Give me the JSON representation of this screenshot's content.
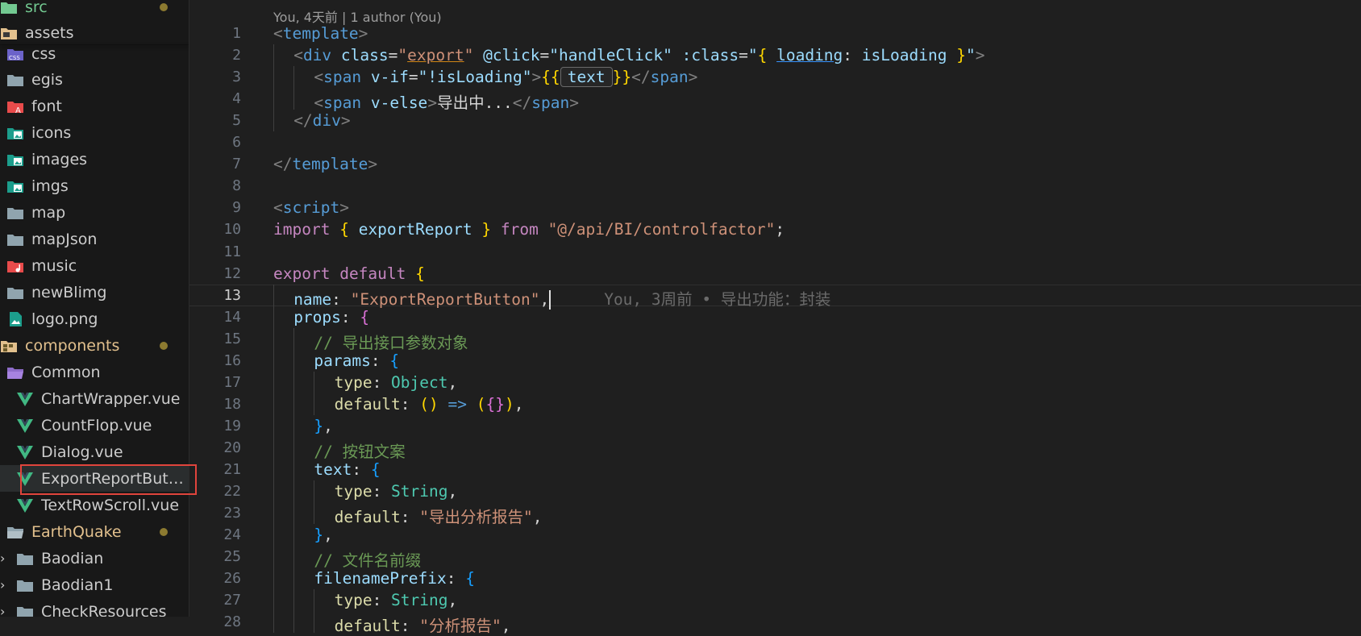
{
  "explorer": {
    "rows": [
      {
        "label": "src",
        "kind": "folder-src",
        "color": "#73c991",
        "modified": true
      },
      {
        "label": "assets",
        "kind": "folder-assets",
        "color": "#cccccc",
        "modified": false
      },
      {
        "label": "css",
        "kind": "folder-css",
        "color": "#cccccc",
        "modified": false
      },
      {
        "label": "egis",
        "kind": "folder",
        "color": "#cccccc",
        "modified": false
      },
      {
        "label": "font",
        "kind": "folder-font",
        "color": "#cccccc",
        "modified": false
      },
      {
        "label": "icons",
        "kind": "folder-images",
        "color": "#cccccc",
        "modified": false
      },
      {
        "label": "images",
        "kind": "folder-images",
        "color": "#cccccc",
        "modified": false
      },
      {
        "label": "imgs",
        "kind": "folder-images",
        "color": "#cccccc",
        "modified": false
      },
      {
        "label": "map",
        "kind": "folder",
        "color": "#cccccc",
        "modified": false
      },
      {
        "label": "mapJson",
        "kind": "folder",
        "color": "#cccccc",
        "modified": false
      },
      {
        "label": "music",
        "kind": "folder-music",
        "color": "#cccccc",
        "modified": false
      },
      {
        "label": "newBlimg",
        "kind": "folder",
        "color": "#cccccc",
        "modified": false
      },
      {
        "label": "logo.png",
        "kind": "file-image",
        "color": "#cccccc",
        "modified": false
      },
      {
        "label": "components",
        "kind": "folder-components",
        "color": "#e2c08d",
        "modified": true
      },
      {
        "label": "Common",
        "kind": "folder-open-purple",
        "color": "#cccccc",
        "modified": false
      },
      {
        "label": "ChartWrapper.vue",
        "kind": "vue",
        "color": "#cccccc",
        "modified": false
      },
      {
        "label": "CountFlop.vue",
        "kind": "vue",
        "color": "#cccccc",
        "modified": false
      },
      {
        "label": "Dialog.vue",
        "kind": "vue",
        "color": "#cccccc",
        "modified": false
      },
      {
        "label": "ExportReportButto...",
        "kind": "vue",
        "color": "#cccccc",
        "modified": false
      },
      {
        "label": "TextRowScroll.vue",
        "kind": "vue",
        "color": "#cccccc",
        "modified": false
      },
      {
        "label": "EarthQuake",
        "kind": "folder-open",
        "color": "#e2c08d",
        "modified": true
      },
      {
        "label": "Baodian",
        "kind": "folder",
        "color": "#cccccc",
        "modified": false
      },
      {
        "label": "Baodian1",
        "kind": "folder",
        "color": "#cccccc",
        "modified": false
      },
      {
        "label": "CheckResources",
        "kind": "folder",
        "color": "#cccccc",
        "modified": false
      }
    ]
  },
  "editor": {
    "codelens": "You, 4天前 | 1 author (You)",
    "active_line": 13,
    "blame": "You, 3周前 • 导出功能：封装",
    "lines": [
      {
        "n": "1",
        "indent": 0,
        "tokens": [
          [
            "&lt;",
            "t-punc"
          ],
          [
            "template",
            "t-tag"
          ],
          [
            "&gt;",
            "t-punc"
          ]
        ]
      },
      {
        "n": "2",
        "indent": 1,
        "tokens": [
          [
            "&lt;",
            "t-punc"
          ],
          [
            "div",
            "t-tag"
          ],
          [
            " "
          ],
          [
            "class",
            "t-attr"
          ],
          [
            "=",
            "t-op"
          ],
          [
            "\"",
            "t-str"
          ],
          [
            "export",
            "t-str u-orange"
          ],
          [
            "\"",
            "t-str"
          ],
          [
            " "
          ],
          [
            "@click",
            "t-attr"
          ],
          [
            "=",
            "t-op"
          ],
          [
            "\"handleClick\"",
            "t-attr"
          ],
          [
            " "
          ],
          [
            ":class",
            "t-attr"
          ],
          [
            "=",
            "t-op"
          ],
          [
            "\"",
            "t-attr"
          ],
          [
            "{",
            "t-b1"
          ],
          [
            " "
          ],
          [
            "loading",
            "t-var u-blue"
          ],
          [
            ": ",
            "t-op"
          ],
          [
            "isLoading",
            "t-var"
          ],
          [
            " "
          ],
          [
            "}",
            "t-b1"
          ],
          [
            "\"",
            "t-attr"
          ],
          [
            "&gt;",
            "t-punc"
          ]
        ]
      },
      {
        "n": "3",
        "indent": 2,
        "tokens": [
          [
            "&lt;",
            "t-punc"
          ],
          [
            "span",
            "t-tag"
          ],
          [
            " "
          ],
          [
            "v-if",
            "t-attr"
          ],
          [
            "=",
            "t-op"
          ],
          [
            "\"!isLoading\"",
            "t-attr"
          ],
          [
            "&gt;",
            "t-punc"
          ],
          [
            "{{",
            "t-b1"
          ],
          [
            "text",
            "inline-box"
          ],
          [
            "}}",
            "t-b1"
          ],
          [
            "&lt;/",
            "t-punc"
          ],
          [
            "span",
            "t-tag"
          ],
          [
            "&gt;",
            "t-punc"
          ]
        ]
      },
      {
        "n": "4",
        "indent": 2,
        "tokens": [
          [
            "&lt;",
            "t-punc"
          ],
          [
            "span",
            "t-tag"
          ],
          [
            " "
          ],
          [
            "v-else",
            "t-attr"
          ],
          [
            "&gt;",
            "t-punc"
          ],
          [
            "导出中...",
            "t-op"
          ],
          [
            "&lt;/",
            "t-punc"
          ],
          [
            "span",
            "t-tag"
          ],
          [
            "&gt;",
            "t-punc"
          ]
        ]
      },
      {
        "n": "5",
        "indent": 1,
        "tokens": [
          [
            "&lt;/",
            "t-punc"
          ],
          [
            "div",
            "t-tag"
          ],
          [
            "&gt;",
            "t-punc"
          ]
        ]
      },
      {
        "n": "6",
        "indent": 0,
        "tokens": []
      },
      {
        "n": "7",
        "indent": 0,
        "tokens": [
          [
            "&lt;/",
            "t-punc"
          ],
          [
            "template",
            "t-tag"
          ],
          [
            "&gt;",
            "t-punc"
          ]
        ]
      },
      {
        "n": "8",
        "indent": 0,
        "tokens": []
      },
      {
        "n": "9",
        "indent": 0,
        "tokens": [
          [
            "&lt;",
            "t-punc"
          ],
          [
            "script",
            "t-tag"
          ],
          [
            "&gt;",
            "t-punc"
          ]
        ]
      },
      {
        "n": "10",
        "indent": 0,
        "tokens": [
          [
            "import",
            "t-kw"
          ],
          [
            " "
          ],
          [
            "{",
            "t-b1"
          ],
          [
            " "
          ],
          [
            "exportReport",
            "t-var"
          ],
          [
            " "
          ],
          [
            "}",
            "t-b1"
          ],
          [
            " "
          ],
          [
            "from",
            "t-kw"
          ],
          [
            " "
          ],
          [
            "\"@/api/BI/controlfactor\"",
            "t-str"
          ],
          [
            ";",
            "t-op"
          ]
        ]
      },
      {
        "n": "11",
        "indent": 0,
        "tokens": []
      },
      {
        "n": "12",
        "indent": 0,
        "tokens": [
          [
            "export",
            "t-kw"
          ],
          [
            " "
          ],
          [
            "default",
            "t-kw"
          ],
          [
            " "
          ],
          [
            "{",
            "t-b1"
          ]
        ]
      },
      {
        "n": "13",
        "indent": 1,
        "tokens": [
          [
            "name",
            "t-var"
          ],
          [
            ": ",
            "t-op"
          ],
          [
            "\"ExportReportButton\"",
            "t-str"
          ],
          [
            ",",
            "t-op"
          ]
        ]
      },
      {
        "n": "14",
        "indent": 1,
        "tokens": [
          [
            "props",
            "t-var"
          ],
          [
            ": ",
            "t-op"
          ],
          [
            "{",
            "t-b2"
          ]
        ]
      },
      {
        "n": "15",
        "indent": 2,
        "tokens": [
          [
            "// 导出接口参数对象",
            "t-cm"
          ]
        ]
      },
      {
        "n": "16",
        "indent": 2,
        "tokens": [
          [
            "params",
            "t-var"
          ],
          [
            ": ",
            "t-op"
          ],
          [
            "{",
            "t-b3"
          ]
        ]
      },
      {
        "n": "17",
        "indent": 3,
        "tokens": [
          [
            "type",
            "t-fn"
          ],
          [
            ": ",
            "t-op"
          ],
          [
            "Object",
            "t-type"
          ],
          [
            ",",
            "t-op"
          ]
        ]
      },
      {
        "n": "18",
        "indent": 3,
        "tokens": [
          [
            "default",
            "t-fn"
          ],
          [
            ": ",
            "t-op"
          ],
          [
            "()",
            "t-b1"
          ],
          [
            " "
          ],
          [
            "=&gt;",
            "t-tag"
          ],
          [
            " "
          ],
          [
            "(",
            "t-b1"
          ],
          [
            "{}",
            "t-b2"
          ],
          [
            ")",
            "t-b1"
          ],
          [
            ",",
            "t-op"
          ]
        ]
      },
      {
        "n": "19",
        "indent": 2,
        "tokens": [
          [
            "}",
            "t-b3"
          ],
          [
            ",",
            "t-op"
          ]
        ]
      },
      {
        "n": "20",
        "indent": 2,
        "tokens": [
          [
            "// 按钮文案",
            "t-cm"
          ]
        ]
      },
      {
        "n": "21",
        "indent": 2,
        "tokens": [
          [
            "text",
            "t-var"
          ],
          [
            ": ",
            "t-op"
          ],
          [
            "{",
            "t-b3"
          ]
        ]
      },
      {
        "n": "22",
        "indent": 3,
        "tokens": [
          [
            "type",
            "t-fn"
          ],
          [
            ": ",
            "t-op"
          ],
          [
            "String",
            "t-type"
          ],
          [
            ",",
            "t-op"
          ]
        ]
      },
      {
        "n": "23",
        "indent": 3,
        "tokens": [
          [
            "default",
            "t-fn"
          ],
          [
            ": ",
            "t-op"
          ],
          [
            "\"导出分析报告\"",
            "t-str"
          ],
          [
            ",",
            "t-op"
          ]
        ]
      },
      {
        "n": "24",
        "indent": 2,
        "tokens": [
          [
            "}",
            "t-b3"
          ],
          [
            ",",
            "t-op"
          ]
        ]
      },
      {
        "n": "25",
        "indent": 2,
        "tokens": [
          [
            "// 文件名前缀",
            "t-cm"
          ]
        ]
      },
      {
        "n": "26",
        "indent": 2,
        "tokens": [
          [
            "filenamePrefix",
            "t-var"
          ],
          [
            ": ",
            "t-op"
          ],
          [
            "{",
            "t-b3"
          ]
        ]
      },
      {
        "n": "27",
        "indent": 3,
        "tokens": [
          [
            "type",
            "t-fn"
          ],
          [
            ": ",
            "t-op"
          ],
          [
            "String",
            "t-type"
          ],
          [
            ",",
            "t-op"
          ]
        ]
      },
      {
        "n": "28",
        "indent": 3,
        "tokens": [
          [
            "default",
            "t-fn"
          ],
          [
            ": ",
            "t-op"
          ],
          [
            "\"分析报告\"",
            "t-str"
          ],
          [
            ",",
            "t-op"
          ]
        ]
      }
    ]
  }
}
